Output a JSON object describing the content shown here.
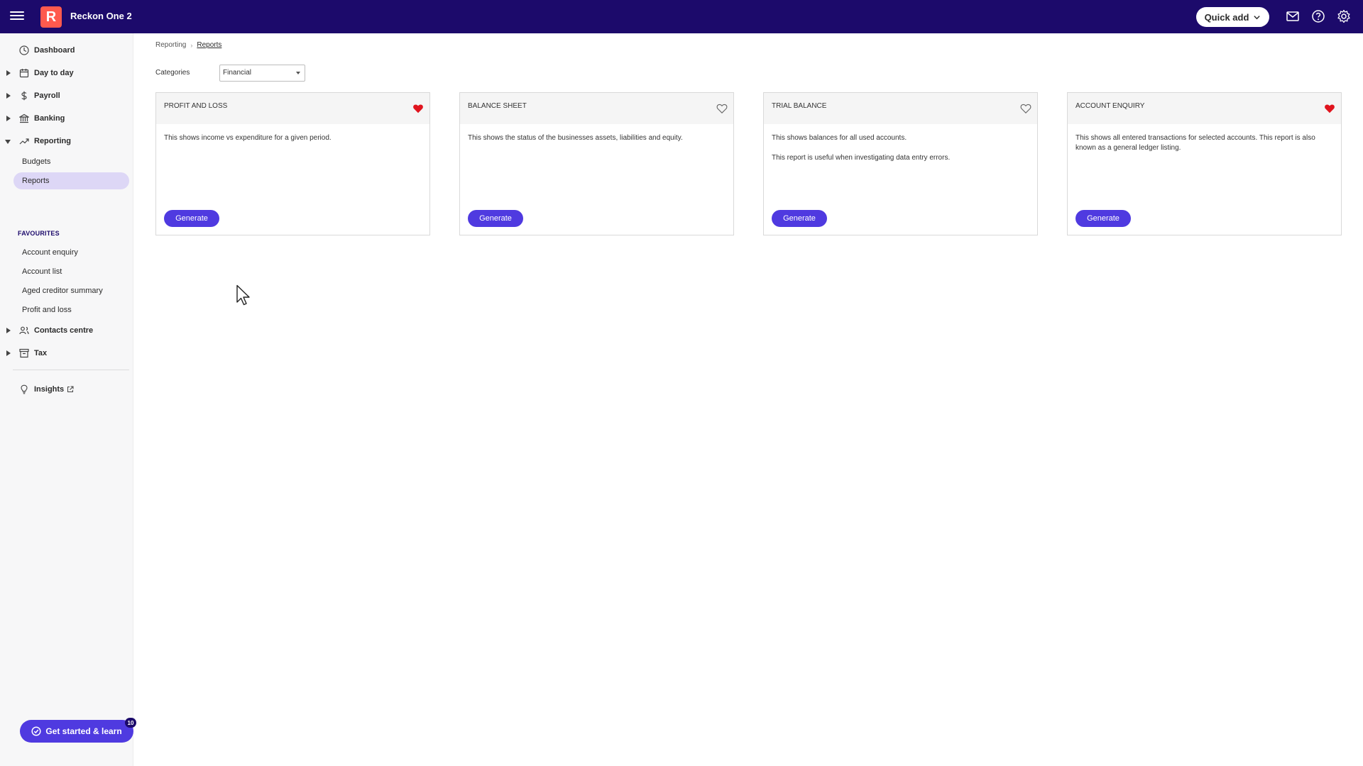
{
  "header": {
    "app_title": "Reckon One 2",
    "logo_letter": "R",
    "quick_add_label": "Quick add",
    "brand_color": "#1c0a6b",
    "logo_color": "#ff5a4e"
  },
  "sidebar": {
    "items": [
      {
        "label": "Dashboard",
        "icon": "dashboard-icon"
      },
      {
        "label": "Day to day",
        "icon": "calendar-icon"
      },
      {
        "label": "Payroll",
        "icon": "dollar-icon"
      },
      {
        "label": "Banking",
        "icon": "bank-icon"
      },
      {
        "label": "Reporting",
        "icon": "trend-icon"
      },
      {
        "label": "Contacts centre",
        "icon": "contacts-icon"
      },
      {
        "label": "Tax",
        "icon": "tax-icon"
      },
      {
        "label": "Insights",
        "icon": "lightbulb-icon"
      }
    ],
    "reporting_sub": [
      "Budgets",
      "Reports"
    ],
    "favourites_heading": "FAVOURITES",
    "favourites": [
      "Account enquiry",
      "Account list",
      "Aged creditor summary",
      "Profit and loss"
    ],
    "get_started_label": "Get started & learn",
    "get_started_badge": "10"
  },
  "breadcrumb": {
    "parent": "Reporting",
    "current": "Reports"
  },
  "filter": {
    "label": "Categories",
    "selected": "Financial"
  },
  "cards": [
    {
      "title": "PROFIT AND LOSS",
      "favourite": true,
      "desc1": "This shows income vs expenditure for a given period.",
      "desc2": "",
      "button": "Generate"
    },
    {
      "title": "BALANCE SHEET",
      "favourite": false,
      "desc1": "This shows the status of the businesses assets, liabilities and equity.",
      "desc2": "",
      "button": "Generate"
    },
    {
      "title": "TRIAL BALANCE",
      "favourite": false,
      "desc1": "This shows balances for all used accounts.",
      "desc2": "This report is useful when investigating data entry errors.",
      "button": "Generate"
    },
    {
      "title": "ACCOUNT ENQUIRY",
      "favourite": true,
      "desc1": "This shows all entered transactions for selected accounts. This report is also known as a general ledger listing.",
      "desc2": "",
      "button": "Generate"
    }
  ],
  "colors": {
    "accent": "#4f3ae0",
    "favourite_heart": "#e0141e",
    "active_nav": "#ddd7f6"
  }
}
